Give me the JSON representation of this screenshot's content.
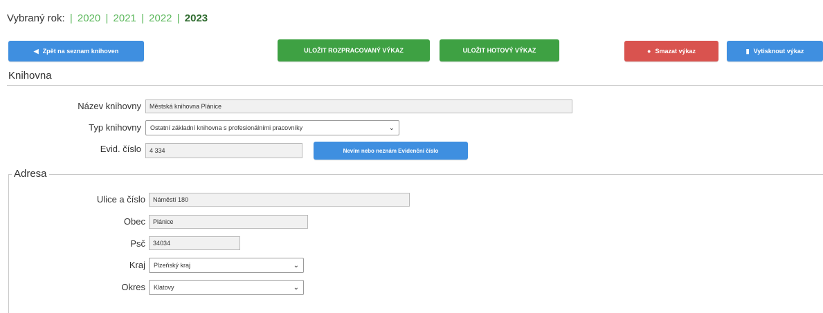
{
  "year_selector": {
    "label": "Vybraný rok:",
    "years": [
      "2020",
      "2021",
      "2022",
      "2023"
    ],
    "selected": "2023"
  },
  "toolbar": {
    "back_label": "Zpět na seznam knihoven",
    "save_draft_label": "ULOŽIT ROZPRACOVANÝ VÝKAZ",
    "save_final_label": "ULOŽIT HOTOVÝ VÝKAZ",
    "delete_label": "Smazat výkaz",
    "print_label": "Vytisknout výkaz"
  },
  "knihovna": {
    "title": "Knihovna",
    "name_label": "Název knihovny",
    "name_value": "Městská knihovna Plánice",
    "type_label": "Typ knihovny",
    "type_value": "Ostatní základní knihovna s profesionálními pracovníky",
    "evid_label": "Evid. číslo",
    "evid_value": "4 334",
    "evid_button": "Nevím nebo neznám Evidenční číslo"
  },
  "adresa": {
    "title": "Adresa",
    "street_label": "Ulice a číslo",
    "street_value": "Náměstí 180",
    "city_label": "Obec",
    "city_value": "Plánice",
    "psc_label": "Psč",
    "psc_value": "34034",
    "kraj_label": "Kraj",
    "kraj_value": "Plzeňský kraj",
    "okres_label": "Okres",
    "okres_value": "Klatovy"
  },
  "colors": {
    "blue": "#3f8fe0",
    "green": "#3ea143",
    "red": "#d9534f",
    "year_link": "#5cb85c"
  }
}
